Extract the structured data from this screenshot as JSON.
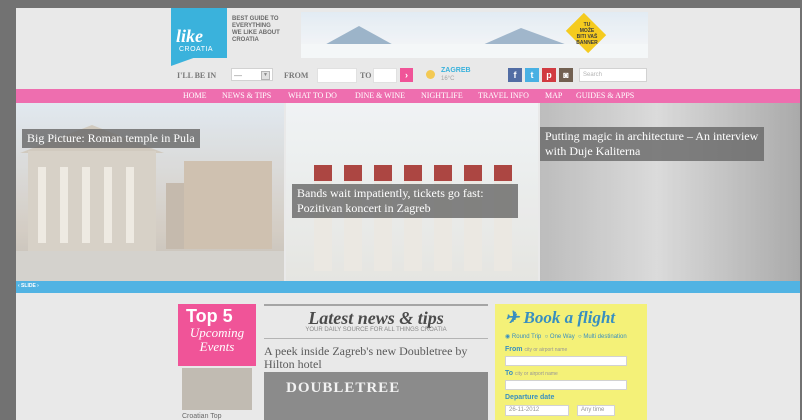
{
  "logo": {
    "text": "like",
    "sub": "CROATIA"
  },
  "tagline": [
    "BEST GUIDE TO",
    "EVERYTHING",
    "WE LIKE ABOUT",
    "CROATIA"
  ],
  "banner": {
    "sign": [
      "TU",
      "MOŽE",
      "BITI VAŠ",
      "BANNER"
    ]
  },
  "search_bar": {
    "i_will_be_in": "I'LL BE IN",
    "select_value": "—",
    "from": "FROM",
    "to": "TO",
    "go": "›",
    "city": "ZAGREB",
    "temperature": "16°C",
    "search_placeholder": "Search"
  },
  "social": [
    {
      "name": "facebook-icon",
      "glyph": "f",
      "color": "#3b5998"
    },
    {
      "name": "twitter-icon",
      "glyph": "t",
      "color": "#2fa6e0"
    },
    {
      "name": "pinterest-icon",
      "glyph": "p",
      "color": "#cb2027"
    },
    {
      "name": "instagram-icon",
      "glyph": "◙",
      "color": "#5f4a3a"
    }
  ],
  "nav": [
    "HOME",
    "NEWS & TIPS",
    "WHAT TO DO",
    "DINE & WINE",
    "NIGHTLIFE",
    "TRAVEL INFO",
    "MAP",
    "GUIDES & APPS"
  ],
  "slides": [
    {
      "caption": "Big Picture: Roman temple in Pula"
    },
    {
      "caption": "Bands wait impatiently, tickets go fast: Pozitivan koncert in Zagreb"
    },
    {
      "caption": "Putting magic in architecture – An interview with Duje Kaliterna"
    }
  ],
  "slider_control": "‹ SLIDE ›",
  "top5": {
    "title": "Top 5",
    "subtitle": "Upcoming Events",
    "caption": "Croatian Top"
  },
  "news": {
    "title": "Latest news & tips",
    "subtitle": "YOUR DAILY SOURCE FOR ALL THINGS CROATIA",
    "first_item": "A peek inside Zagreb's new Doubletree by Hilton hotel",
    "image_text": "DOUBLETREE"
  },
  "flight": {
    "title": "Book a flight",
    "options": [
      "Round Trip",
      "One Way",
      "Multi destination"
    ],
    "from_label": "From",
    "from_hint": "city or airport name",
    "to_label": "To",
    "to_hint": "city or airport name",
    "departure_label": "Departure date",
    "departure_value": "26-11-2012",
    "time_value": "Any time"
  },
  "colors": {
    "accent_pink": "#ec5aa4",
    "accent_blue": "#1fa8d8",
    "flight_yellow": "#f3ef66"
  }
}
